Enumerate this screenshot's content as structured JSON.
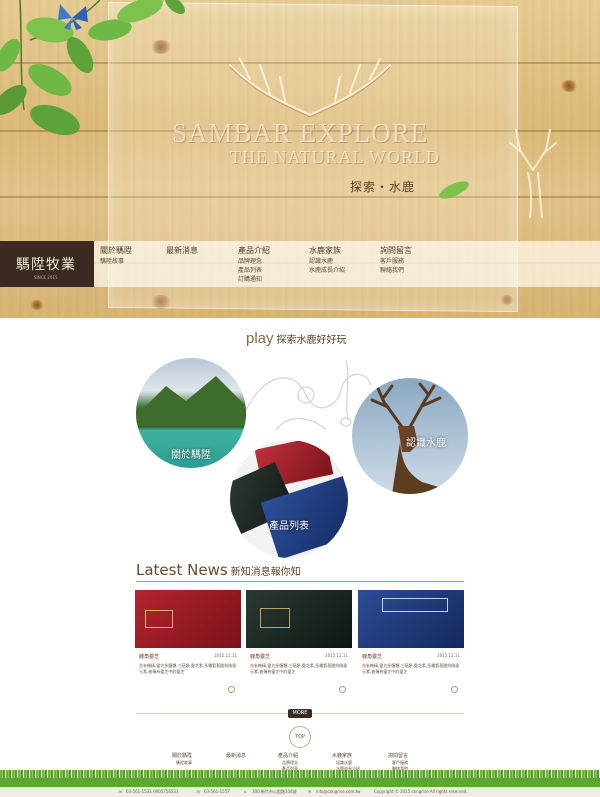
{
  "hero": {
    "brand_line1": "SAMBAR EXPLORE",
    "brand_line2": "THE NATURAL WORLD",
    "tagline": "探索・水鹿"
  },
  "logo": {
    "title": "騳陞牧業",
    "subtitle": "SINCE 2015"
  },
  "nav": [
    {
      "label": "關於騳陞",
      "sub": [
        "騳陞故事"
      ]
    },
    {
      "label": "最新消息",
      "sub": []
    },
    {
      "label": "產品介紹",
      "sub": [
        "品牌理念",
        "產品列表",
        "訂購通知"
      ]
    },
    {
      "label": "水鹿家族",
      "sub": [
        "認識水鹿",
        "水鹿成長介紹"
      ]
    },
    {
      "label": "詢問留言",
      "sub": [
        "客戶服務",
        "聯絡我們"
      ]
    }
  ],
  "play": {
    "en": "play",
    "zh": "探索水鹿好好玩"
  },
  "circles": {
    "about": "關於騳陞",
    "products": "產品列表",
    "deer": "認識水鹿"
  },
  "news": {
    "title_en": "Latest News",
    "title_zh": "新知消息報你知",
    "items": [
      {
        "title": "鹿角靈芝",
        "date": "2015.12.11",
        "desc": "含有機精,靈芝多醣體,三萜類,靈芝素,多種氨基酸與微量元素,被稱為靈芝中的靈芝"
      },
      {
        "title": "鹿角靈芝",
        "date": "2015.12.11",
        "desc": "含有機精,靈芝多醣體,三萜類,靈芝素,多種氨基酸與微量元素,被稱為靈芝中的靈芝"
      },
      {
        "title": "鹿角靈芝",
        "date": "2015.12.11",
        "desc": "含有機精,靈芝多醣體,三萜類,靈芝素,多種氨基酸與微量元素,被稱為靈芝中的靈芝"
      }
    ],
    "more": "MORE",
    "top": "TOP"
  },
  "footer": {
    "cols": [
      {
        "label": "關於騳陞",
        "sub": [
          "騳陞故事"
        ]
      },
      {
        "label": "最新消息",
        "sub": []
      },
      {
        "label": "產品介紹",
        "sub": [
          "品牌理念",
          "產品列表",
          "訂購通知"
        ]
      },
      {
        "label": "水鹿家族",
        "sub": [
          "認識水鹿",
          "水鹿成長介紹"
        ]
      },
      {
        "label": "詢問留言",
        "sub": [
          "客戶服務",
          "聯絡我們"
        ]
      }
    ],
    "phone1": "03-561-1531  0905756531",
    "phone2": "03-561-1557",
    "address": "300 新竹市公園路104號",
    "email": "info@congrise.com.tw",
    "copyright": "Copyright © 2015 congrise All rights reserved."
  },
  "colors": {
    "accent": "#3a2a20",
    "wood": "#dcbc7c",
    "brown_text": "#5b4326"
  }
}
